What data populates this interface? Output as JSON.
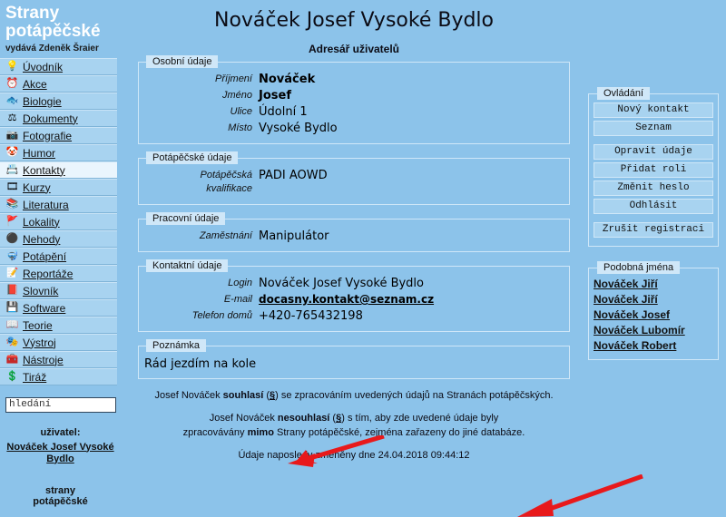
{
  "brand": {
    "line1": "Strany",
    "line2": "potápěčské",
    "publisher": "vydává Zdeněk Šraier",
    "footer_line1": "strany",
    "footer_line2": "potápěčské"
  },
  "sidebar": {
    "items": [
      {
        "label": "Úvodník",
        "icon": "lightbulb-icon",
        "glyph": "💡",
        "active": false
      },
      {
        "label": "Akce",
        "icon": "clock-icon",
        "glyph": "⏰",
        "active": false
      },
      {
        "label": "Biologie",
        "icon": "fish-icon",
        "glyph": "🐟",
        "active": false
      },
      {
        "label": "Dokumenty",
        "icon": "stamp-icon",
        "glyph": "⚖",
        "active": false
      },
      {
        "label": "Fotografie",
        "icon": "camera-icon",
        "glyph": "📷",
        "active": false
      },
      {
        "label": "Humor",
        "icon": "clown-icon",
        "glyph": "🤡",
        "active": false
      },
      {
        "label": "Kontakty",
        "icon": "contacts-icon",
        "glyph": "📇",
        "active": true
      },
      {
        "label": "Kurzy",
        "icon": "projector-icon",
        "glyph": "🎞",
        "active": false
      },
      {
        "label": "Literatura",
        "icon": "books-icon",
        "glyph": "📚",
        "active": false
      },
      {
        "label": "Lokality",
        "icon": "diveflag-icon",
        "glyph": "🚩",
        "active": false
      },
      {
        "label": "Nehody",
        "icon": "balloon-icon",
        "glyph": "⚫",
        "active": false
      },
      {
        "label": "Potápění",
        "icon": "diver-icon",
        "glyph": "🤿",
        "active": false
      },
      {
        "label": "Reportáže",
        "icon": "notepad-icon",
        "glyph": "📝",
        "active": false
      },
      {
        "label": "Slovník",
        "icon": "dictionary-icon",
        "glyph": "📕",
        "active": false
      },
      {
        "label": "Software",
        "icon": "floppy-icon",
        "glyph": "💾",
        "active": false
      },
      {
        "label": "Teorie",
        "icon": "book-icon",
        "glyph": "📖",
        "active": false
      },
      {
        "label": "Výstroj",
        "icon": "gear-mask-icon",
        "glyph": "🎭",
        "active": false
      },
      {
        "label": "Nástroje",
        "icon": "tools-icon",
        "glyph": "🧰",
        "active": false
      },
      {
        "label": "Tiráž",
        "icon": "dollar-icon",
        "glyph": "💲",
        "active": false
      }
    ],
    "search": {
      "value": "hledání",
      "placeholder": "hledání"
    },
    "user": {
      "label": "uživatel:",
      "name": "Nováček Josef Vysoké Bydlo"
    }
  },
  "main": {
    "title": "Nováček Josef Vysoké Bydlo",
    "subtitle": "Adresář uživatelů",
    "fieldsets": [
      {
        "legend": "Osobní údaje",
        "rows": [
          {
            "label": "Příjmení",
            "value": "Nováček",
            "style": "bold"
          },
          {
            "label": "Jméno",
            "value": "Josef",
            "style": "bold"
          },
          {
            "label": "Ulice",
            "value": "Údolní 1",
            "style": "plain"
          },
          {
            "label": "Místo",
            "value": "Vysoké Bydlo",
            "style": "plain"
          }
        ]
      },
      {
        "legend": "Potápěčské údaje",
        "rows": [
          {
            "label": "Potápěčská\nkvalifikace",
            "value": "PADI AOWD",
            "style": "plain"
          }
        ]
      },
      {
        "legend": "Pracovní údaje",
        "rows": [
          {
            "label": "Zaměstnání",
            "value": "Manipulátor",
            "style": "plain"
          }
        ]
      },
      {
        "legend": "Kontaktní údaje",
        "rows": [
          {
            "label": "Login",
            "value": "Nováček Josef Vysoké Bydlo",
            "style": "plain"
          },
          {
            "label": "E-mail",
            "value": "docasny.kontakt@seznam.cz",
            "style": "link"
          },
          {
            "label": "Telefon domů",
            "value": "+420-765432198",
            "style": "plain"
          }
        ]
      }
    ],
    "note": {
      "legend": "Poznámka",
      "text": "Rád jezdím na kole"
    },
    "consent": {
      "line1_a": "Josef Nováček ",
      "line1_b": "souhlasí",
      "line1_c": " (",
      "line1_d": "§",
      "line1_e": ") se zpracováním uvedených údajů na Stranách potápěčských.",
      "line2_a": "Josef Nováček ",
      "line2_b": "nesouhlasí",
      "line2_c": " (",
      "line2_d": "§",
      "line2_e": ") s tím, aby zde uvedené údaje byly",
      "line3_a": "zpracovávány ",
      "line3_b": "mimo",
      "line3_c": " Strany potápěčské, zejména zařazeny do jiné databáze."
    },
    "changed": "Údaje naposledy změněny dne 24.04.2018 09:44:12"
  },
  "rightbar": {
    "controls": {
      "legend": "Ovládání",
      "buttons": [
        "Nový kontakt",
        "Seznam",
        "Opravit údaje",
        "Přidat roli",
        "Změnit heslo",
        "Odhlásit",
        "Zrušit registraci"
      ]
    },
    "similar": {
      "legend": "Podobná jména",
      "names": [
        "Nováček Jiří",
        "Nováček Jiří",
        "Nováček Josef",
        "Nováček Lubomír",
        "Nováček Robert"
      ]
    }
  },
  "colors": {
    "background": "#8cc3ea",
    "panel": "#a8d3f0",
    "legend_bg": "#cfe7f8",
    "active_item": "#eaf5fd",
    "brand_text": "#ffffff",
    "arrow": "#e8191b"
  }
}
